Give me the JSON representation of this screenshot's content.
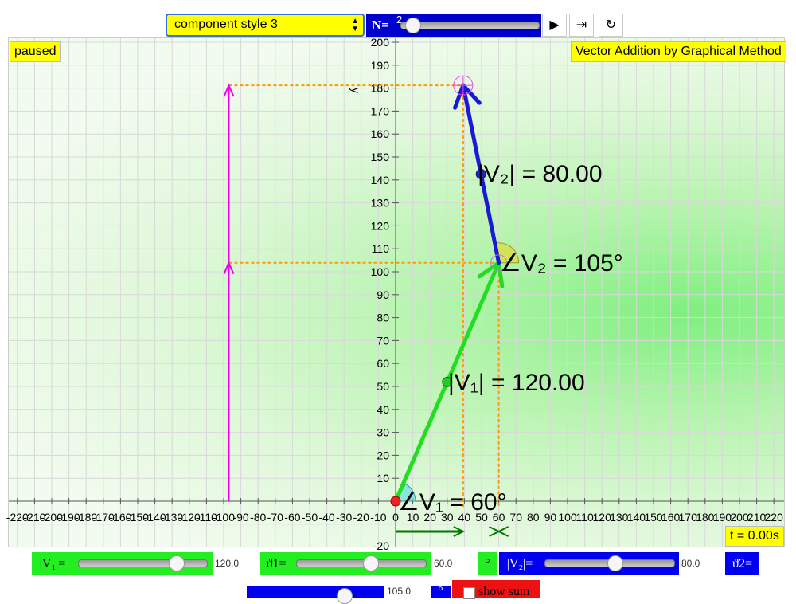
{
  "controls": {
    "style_select": "component style 3",
    "n_label": "N=",
    "n_value": "2",
    "play_icon": "play-icon",
    "step_icon": "step-forward-icon",
    "reset_icon": "reset-icon"
  },
  "status": "paused",
  "title": "Vector Addition by Graphical Method",
  "time_readout": "t = 0.00s",
  "axes": {
    "x_label": "x",
    "y_label": "y",
    "x_ticks": [
      -220,
      -210,
      -200,
      -190,
      -180,
      -170,
      -160,
      -150,
      -140,
      -130,
      -120,
      -110,
      -100,
      -90,
      -80,
      -70,
      -60,
      -50,
      -40,
      -30,
      -20,
      -10,
      0,
      10,
      20,
      30,
      40,
      50,
      60,
      70,
      80,
      90,
      100,
      110,
      120,
      130,
      140,
      150,
      160,
      170,
      180,
      190,
      200,
      210,
      220
    ],
    "y_ticks": [
      10,
      20,
      30,
      40,
      50,
      60,
      70,
      80,
      90,
      100,
      110,
      120,
      130,
      140,
      150,
      160,
      170,
      180,
      190,
      200
    ],
    "y_bottom_tick": "-20"
  },
  "vectors": {
    "v1": {
      "magnitude_label": "|V₁| = 120.00",
      "angle_label": "∠V₁ = 60°",
      "magnitude": 120,
      "angle": 60,
      "color": "#22dd22"
    },
    "v2": {
      "magnitude_label": "|V₂| = 80.00",
      "angle_label": "∠V₂ = 105°",
      "magnitude": 80,
      "angle": 105,
      "color": "#1a1ad6"
    }
  },
  "sliders": {
    "v1_mag_label": "|V₁|=",
    "v1_mag_value": "120.0",
    "v1_mag_fraction": 0.8,
    "theta1_label": "ϑ1=",
    "theta1_value": "60.0",
    "theta1_fraction": 0.58,
    "deg_symbol": "°",
    "v2_mag_label": "|V₂|=",
    "v2_mag_value": "80.0",
    "v2_mag_fraction": 0.55,
    "theta2_label": "ϑ2=",
    "theta2_value": "105.0",
    "theta2_fraction": 0.75,
    "show_sum_label": "show sum"
  }
}
